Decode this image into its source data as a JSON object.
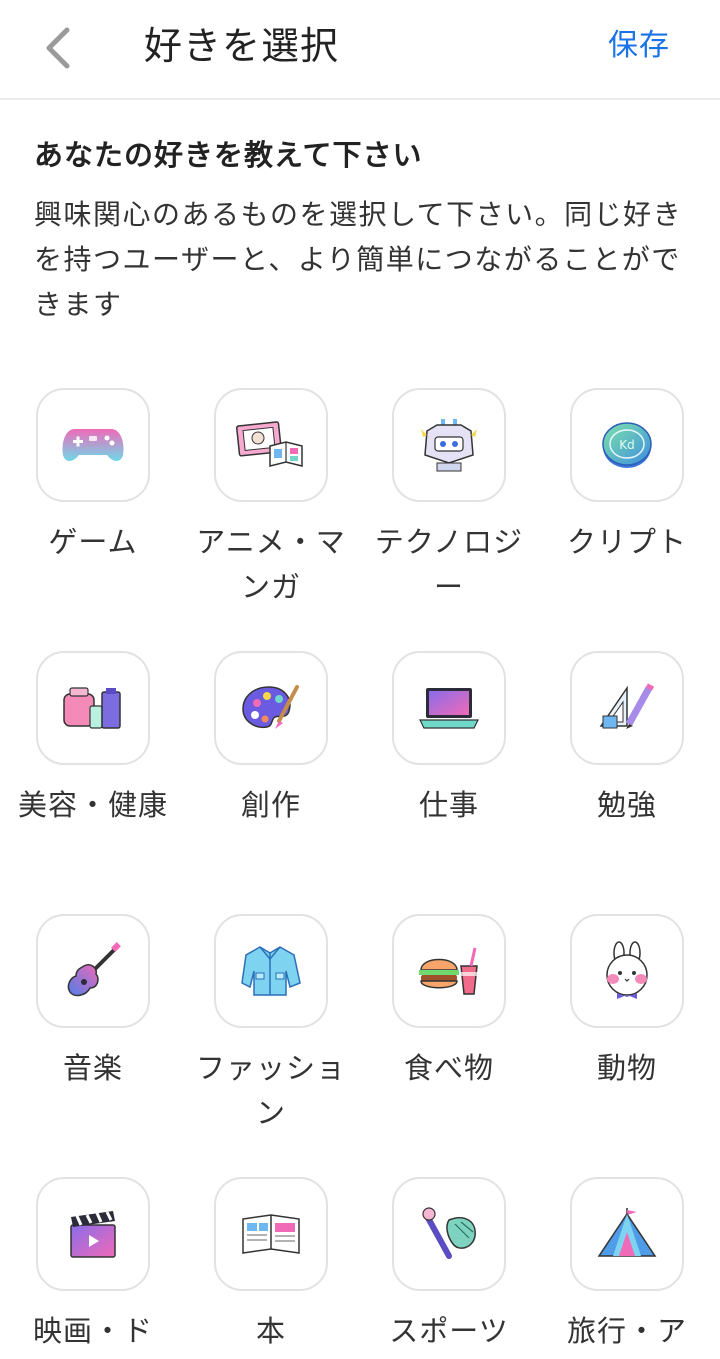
{
  "header": {
    "title": "好きを選択",
    "save_label": "保存"
  },
  "intro": {
    "heading": "あなたの好きを教えて下さい",
    "body": "興味関心のあるものを選択して下さい。同じ好きを持つユーザーと、より簡単につながることができます"
  },
  "categories": [
    {
      "label": "ゲーム",
      "icon": "game-controller-icon"
    },
    {
      "label": "アニメ・マンガ",
      "icon": "anime-manga-icon"
    },
    {
      "label": "テクノロジー",
      "icon": "robot-icon"
    },
    {
      "label": "クリプト",
      "icon": "crypto-coin-icon"
    },
    {
      "label": "美容・健康",
      "icon": "cosmetics-icon"
    },
    {
      "label": "創作",
      "icon": "paint-palette-icon"
    },
    {
      "label": "仕事",
      "icon": "laptop-icon"
    },
    {
      "label": "勉強",
      "icon": "pencil-ruler-icon"
    },
    {
      "label": "音楽",
      "icon": "guitar-icon"
    },
    {
      "label": "ファッション",
      "icon": "jacket-icon"
    },
    {
      "label": "食べ物",
      "icon": "burger-icon"
    },
    {
      "label": "動物",
      "icon": "rabbit-icon"
    },
    {
      "label": "映画・ド",
      "icon": "clapperboard-icon"
    },
    {
      "label": "本",
      "icon": "open-book-icon"
    },
    {
      "label": "スポーツ",
      "icon": "baseball-icon"
    },
    {
      "label": "旅行・ア",
      "icon": "tent-icon"
    }
  ]
}
